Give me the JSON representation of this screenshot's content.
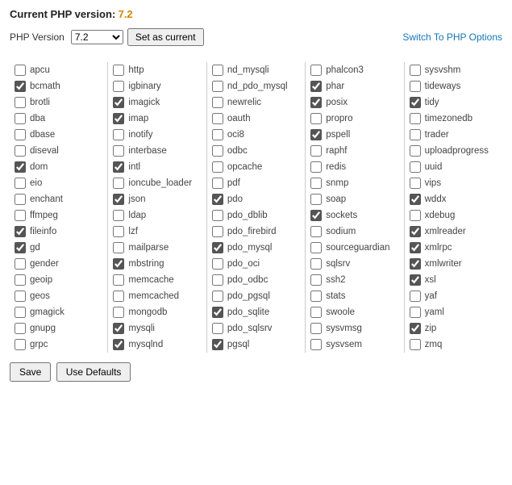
{
  "header": {
    "label": "Current PHP version:",
    "version": "7.2"
  },
  "controls": {
    "php_label": "PHP Version",
    "selected": "7.2",
    "set_button": "Set as current",
    "switch_link": "Switch To PHP Options"
  },
  "columns": [
    [
      {
        "name": "apcu",
        "checked": false
      },
      {
        "name": "bcmath",
        "checked": true
      },
      {
        "name": "brotli",
        "checked": false
      },
      {
        "name": "dba",
        "checked": false
      },
      {
        "name": "dbase",
        "checked": false
      },
      {
        "name": "diseval",
        "checked": false
      },
      {
        "name": "dom",
        "checked": true
      },
      {
        "name": "eio",
        "checked": false
      },
      {
        "name": "enchant",
        "checked": false
      },
      {
        "name": "ffmpeg",
        "checked": false
      },
      {
        "name": "fileinfo",
        "checked": true
      },
      {
        "name": "gd",
        "checked": true
      },
      {
        "name": "gender",
        "checked": false
      },
      {
        "name": "geoip",
        "checked": false
      },
      {
        "name": "geos",
        "checked": false
      },
      {
        "name": "gmagick",
        "checked": false
      },
      {
        "name": "gnupg",
        "checked": false
      },
      {
        "name": "grpc",
        "checked": false
      }
    ],
    [
      {
        "name": "http",
        "checked": false
      },
      {
        "name": "igbinary",
        "checked": false
      },
      {
        "name": "imagick",
        "checked": true
      },
      {
        "name": "imap",
        "checked": true
      },
      {
        "name": "inotify",
        "checked": false
      },
      {
        "name": "interbase",
        "checked": false
      },
      {
        "name": "intl",
        "checked": true
      },
      {
        "name": "ioncube_loader",
        "checked": false
      },
      {
        "name": "json",
        "checked": true
      },
      {
        "name": "ldap",
        "checked": false
      },
      {
        "name": "lzf",
        "checked": false
      },
      {
        "name": "mailparse",
        "checked": false
      },
      {
        "name": "mbstring",
        "checked": true
      },
      {
        "name": "memcache",
        "checked": false
      },
      {
        "name": "memcached",
        "checked": false
      },
      {
        "name": "mongodb",
        "checked": false
      },
      {
        "name": "mysqli",
        "checked": true
      },
      {
        "name": "mysqlnd",
        "checked": true
      }
    ],
    [
      {
        "name": "nd_mysqli",
        "checked": false
      },
      {
        "name": "nd_pdo_mysql",
        "checked": false
      },
      {
        "name": "newrelic",
        "checked": false
      },
      {
        "name": "oauth",
        "checked": false
      },
      {
        "name": "oci8",
        "checked": false
      },
      {
        "name": "odbc",
        "checked": false
      },
      {
        "name": "opcache",
        "checked": false
      },
      {
        "name": "pdf",
        "checked": false
      },
      {
        "name": "pdo",
        "checked": true
      },
      {
        "name": "pdo_dblib",
        "checked": false
      },
      {
        "name": "pdo_firebird",
        "checked": false
      },
      {
        "name": "pdo_mysql",
        "checked": true
      },
      {
        "name": "pdo_oci",
        "checked": false
      },
      {
        "name": "pdo_odbc",
        "checked": false
      },
      {
        "name": "pdo_pgsql",
        "checked": false
      },
      {
        "name": "pdo_sqlite",
        "checked": true
      },
      {
        "name": "pdo_sqlsrv",
        "checked": false
      },
      {
        "name": "pgsql",
        "checked": true
      }
    ],
    [
      {
        "name": "phalcon3",
        "checked": false
      },
      {
        "name": "phar",
        "checked": true
      },
      {
        "name": "posix",
        "checked": true
      },
      {
        "name": "propro",
        "checked": false
      },
      {
        "name": "pspell",
        "checked": true
      },
      {
        "name": "raphf",
        "checked": false
      },
      {
        "name": "redis",
        "checked": false
      },
      {
        "name": "snmp",
        "checked": false
      },
      {
        "name": "soap",
        "checked": false
      },
      {
        "name": "sockets",
        "checked": true
      },
      {
        "name": "sodium",
        "checked": false
      },
      {
        "name": "sourceguardian",
        "checked": false
      },
      {
        "name": "sqlsrv",
        "checked": false
      },
      {
        "name": "ssh2",
        "checked": false
      },
      {
        "name": "stats",
        "checked": false
      },
      {
        "name": "swoole",
        "checked": false
      },
      {
        "name": "sysvmsg",
        "checked": false
      },
      {
        "name": "sysvsem",
        "checked": false
      }
    ],
    [
      {
        "name": "sysvshm",
        "checked": false
      },
      {
        "name": "tideways",
        "checked": false
      },
      {
        "name": "tidy",
        "checked": true
      },
      {
        "name": "timezonedb",
        "checked": false
      },
      {
        "name": "trader",
        "checked": false
      },
      {
        "name": "uploadprogress",
        "checked": false
      },
      {
        "name": "uuid",
        "checked": false
      },
      {
        "name": "vips",
        "checked": false
      },
      {
        "name": "wddx",
        "checked": true
      },
      {
        "name": "xdebug",
        "checked": false
      },
      {
        "name": "xmlreader",
        "checked": true
      },
      {
        "name": "xmlrpc",
        "checked": true
      },
      {
        "name": "xmlwriter",
        "checked": true
      },
      {
        "name": "xsl",
        "checked": true
      },
      {
        "name": "yaf",
        "checked": false
      },
      {
        "name": "yaml",
        "checked": false
      },
      {
        "name": "zip",
        "checked": true
      },
      {
        "name": "zmq",
        "checked": false
      }
    ]
  ],
  "footer": {
    "save": "Save",
    "defaults": "Use Defaults"
  }
}
